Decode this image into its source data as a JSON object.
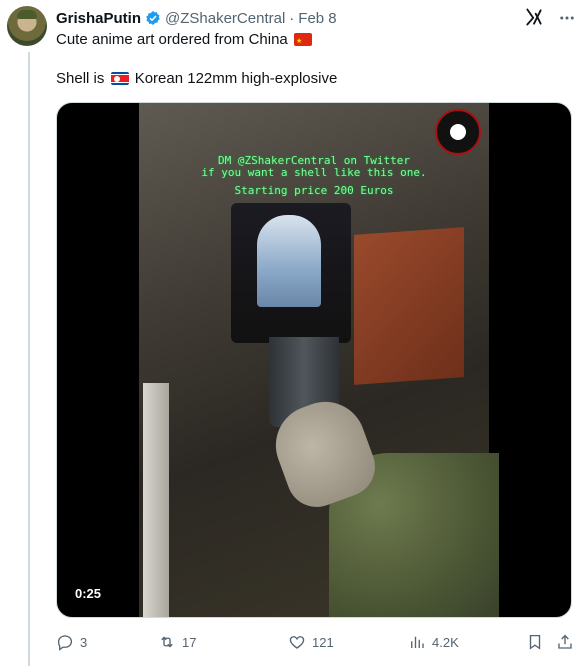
{
  "tweet": {
    "author_name": "GrishaPutin",
    "author_handle": "@ZShakerCentral",
    "separator": "·",
    "date": "Feb 8",
    "text_line1": "Cute anime art ordered from China",
    "text_line2_prefix": "Shell is",
    "text_line2_suffix": "Korean 122mm high-explosive"
  },
  "media": {
    "overlay_line1": "DM @ZShakerCentral on Twitter",
    "overlay_line2": "if you want a shell like this one.",
    "overlay_line3": "Starting price 200 Euros",
    "duration": "0:25"
  },
  "actions": {
    "replies": "3",
    "retweets": "17",
    "likes": "121",
    "views": "4.2K"
  },
  "icons": {
    "verified": "verified-badge-icon",
    "grok": "grok-icon",
    "more": "more-icon",
    "reply": "reply-icon",
    "retweet": "retweet-icon",
    "like": "heart-icon",
    "views": "views-icon",
    "bookmark": "bookmark-icon",
    "share": "share-icon"
  },
  "colors": {
    "accent": "#1d9bf0",
    "muted": "#536471",
    "overlay_text": "#7dff9a"
  }
}
